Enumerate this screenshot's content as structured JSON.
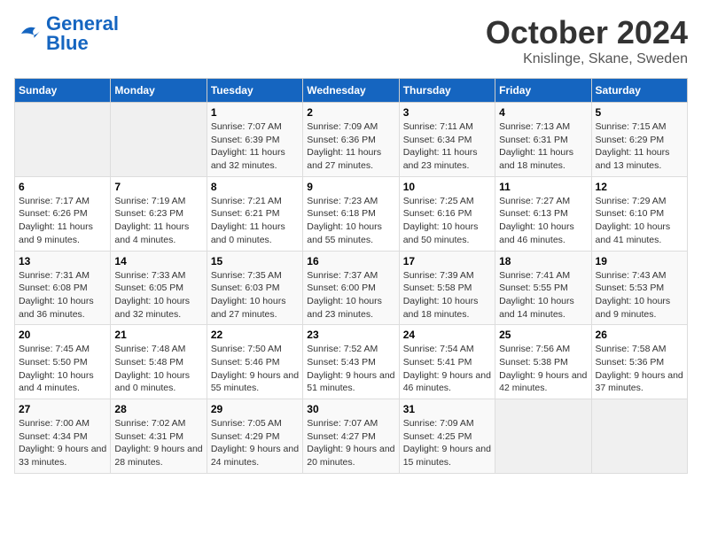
{
  "header": {
    "logo_general": "General",
    "logo_blue": "Blue",
    "month": "October 2024",
    "location": "Knislinge, Skane, Sweden"
  },
  "weekdays": [
    "Sunday",
    "Monday",
    "Tuesday",
    "Wednesday",
    "Thursday",
    "Friday",
    "Saturday"
  ],
  "weeks": [
    [
      {
        "day": "",
        "info": ""
      },
      {
        "day": "",
        "info": ""
      },
      {
        "day": "1",
        "info": "Sunrise: 7:07 AM\nSunset: 6:39 PM\nDaylight: 11 hours and 32 minutes."
      },
      {
        "day": "2",
        "info": "Sunrise: 7:09 AM\nSunset: 6:36 PM\nDaylight: 11 hours and 27 minutes."
      },
      {
        "day": "3",
        "info": "Sunrise: 7:11 AM\nSunset: 6:34 PM\nDaylight: 11 hours and 23 minutes."
      },
      {
        "day": "4",
        "info": "Sunrise: 7:13 AM\nSunset: 6:31 PM\nDaylight: 11 hours and 18 minutes."
      },
      {
        "day": "5",
        "info": "Sunrise: 7:15 AM\nSunset: 6:29 PM\nDaylight: 11 hours and 13 minutes."
      }
    ],
    [
      {
        "day": "6",
        "info": "Sunrise: 7:17 AM\nSunset: 6:26 PM\nDaylight: 11 hours and 9 minutes."
      },
      {
        "day": "7",
        "info": "Sunrise: 7:19 AM\nSunset: 6:23 PM\nDaylight: 11 hours and 4 minutes."
      },
      {
        "day": "8",
        "info": "Sunrise: 7:21 AM\nSunset: 6:21 PM\nDaylight: 11 hours and 0 minutes."
      },
      {
        "day": "9",
        "info": "Sunrise: 7:23 AM\nSunset: 6:18 PM\nDaylight: 10 hours and 55 minutes."
      },
      {
        "day": "10",
        "info": "Sunrise: 7:25 AM\nSunset: 6:16 PM\nDaylight: 10 hours and 50 minutes."
      },
      {
        "day": "11",
        "info": "Sunrise: 7:27 AM\nSunset: 6:13 PM\nDaylight: 10 hours and 46 minutes."
      },
      {
        "day": "12",
        "info": "Sunrise: 7:29 AM\nSunset: 6:10 PM\nDaylight: 10 hours and 41 minutes."
      }
    ],
    [
      {
        "day": "13",
        "info": "Sunrise: 7:31 AM\nSunset: 6:08 PM\nDaylight: 10 hours and 36 minutes."
      },
      {
        "day": "14",
        "info": "Sunrise: 7:33 AM\nSunset: 6:05 PM\nDaylight: 10 hours and 32 minutes."
      },
      {
        "day": "15",
        "info": "Sunrise: 7:35 AM\nSunset: 6:03 PM\nDaylight: 10 hours and 27 minutes."
      },
      {
        "day": "16",
        "info": "Sunrise: 7:37 AM\nSunset: 6:00 PM\nDaylight: 10 hours and 23 minutes."
      },
      {
        "day": "17",
        "info": "Sunrise: 7:39 AM\nSunset: 5:58 PM\nDaylight: 10 hours and 18 minutes."
      },
      {
        "day": "18",
        "info": "Sunrise: 7:41 AM\nSunset: 5:55 PM\nDaylight: 10 hours and 14 minutes."
      },
      {
        "day": "19",
        "info": "Sunrise: 7:43 AM\nSunset: 5:53 PM\nDaylight: 10 hours and 9 minutes."
      }
    ],
    [
      {
        "day": "20",
        "info": "Sunrise: 7:45 AM\nSunset: 5:50 PM\nDaylight: 10 hours and 4 minutes."
      },
      {
        "day": "21",
        "info": "Sunrise: 7:48 AM\nSunset: 5:48 PM\nDaylight: 10 hours and 0 minutes."
      },
      {
        "day": "22",
        "info": "Sunrise: 7:50 AM\nSunset: 5:46 PM\nDaylight: 9 hours and 55 minutes."
      },
      {
        "day": "23",
        "info": "Sunrise: 7:52 AM\nSunset: 5:43 PM\nDaylight: 9 hours and 51 minutes."
      },
      {
        "day": "24",
        "info": "Sunrise: 7:54 AM\nSunset: 5:41 PM\nDaylight: 9 hours and 46 minutes."
      },
      {
        "day": "25",
        "info": "Sunrise: 7:56 AM\nSunset: 5:38 PM\nDaylight: 9 hours and 42 minutes."
      },
      {
        "day": "26",
        "info": "Sunrise: 7:58 AM\nSunset: 5:36 PM\nDaylight: 9 hours and 37 minutes."
      }
    ],
    [
      {
        "day": "27",
        "info": "Sunrise: 7:00 AM\nSunset: 4:34 PM\nDaylight: 9 hours and 33 minutes."
      },
      {
        "day": "28",
        "info": "Sunrise: 7:02 AM\nSunset: 4:31 PM\nDaylight: 9 hours and 28 minutes."
      },
      {
        "day": "29",
        "info": "Sunrise: 7:05 AM\nSunset: 4:29 PM\nDaylight: 9 hours and 24 minutes."
      },
      {
        "day": "30",
        "info": "Sunrise: 7:07 AM\nSunset: 4:27 PM\nDaylight: 9 hours and 20 minutes."
      },
      {
        "day": "31",
        "info": "Sunrise: 7:09 AM\nSunset: 4:25 PM\nDaylight: 9 hours and 15 minutes."
      },
      {
        "day": "",
        "info": ""
      },
      {
        "day": "",
        "info": ""
      }
    ]
  ]
}
